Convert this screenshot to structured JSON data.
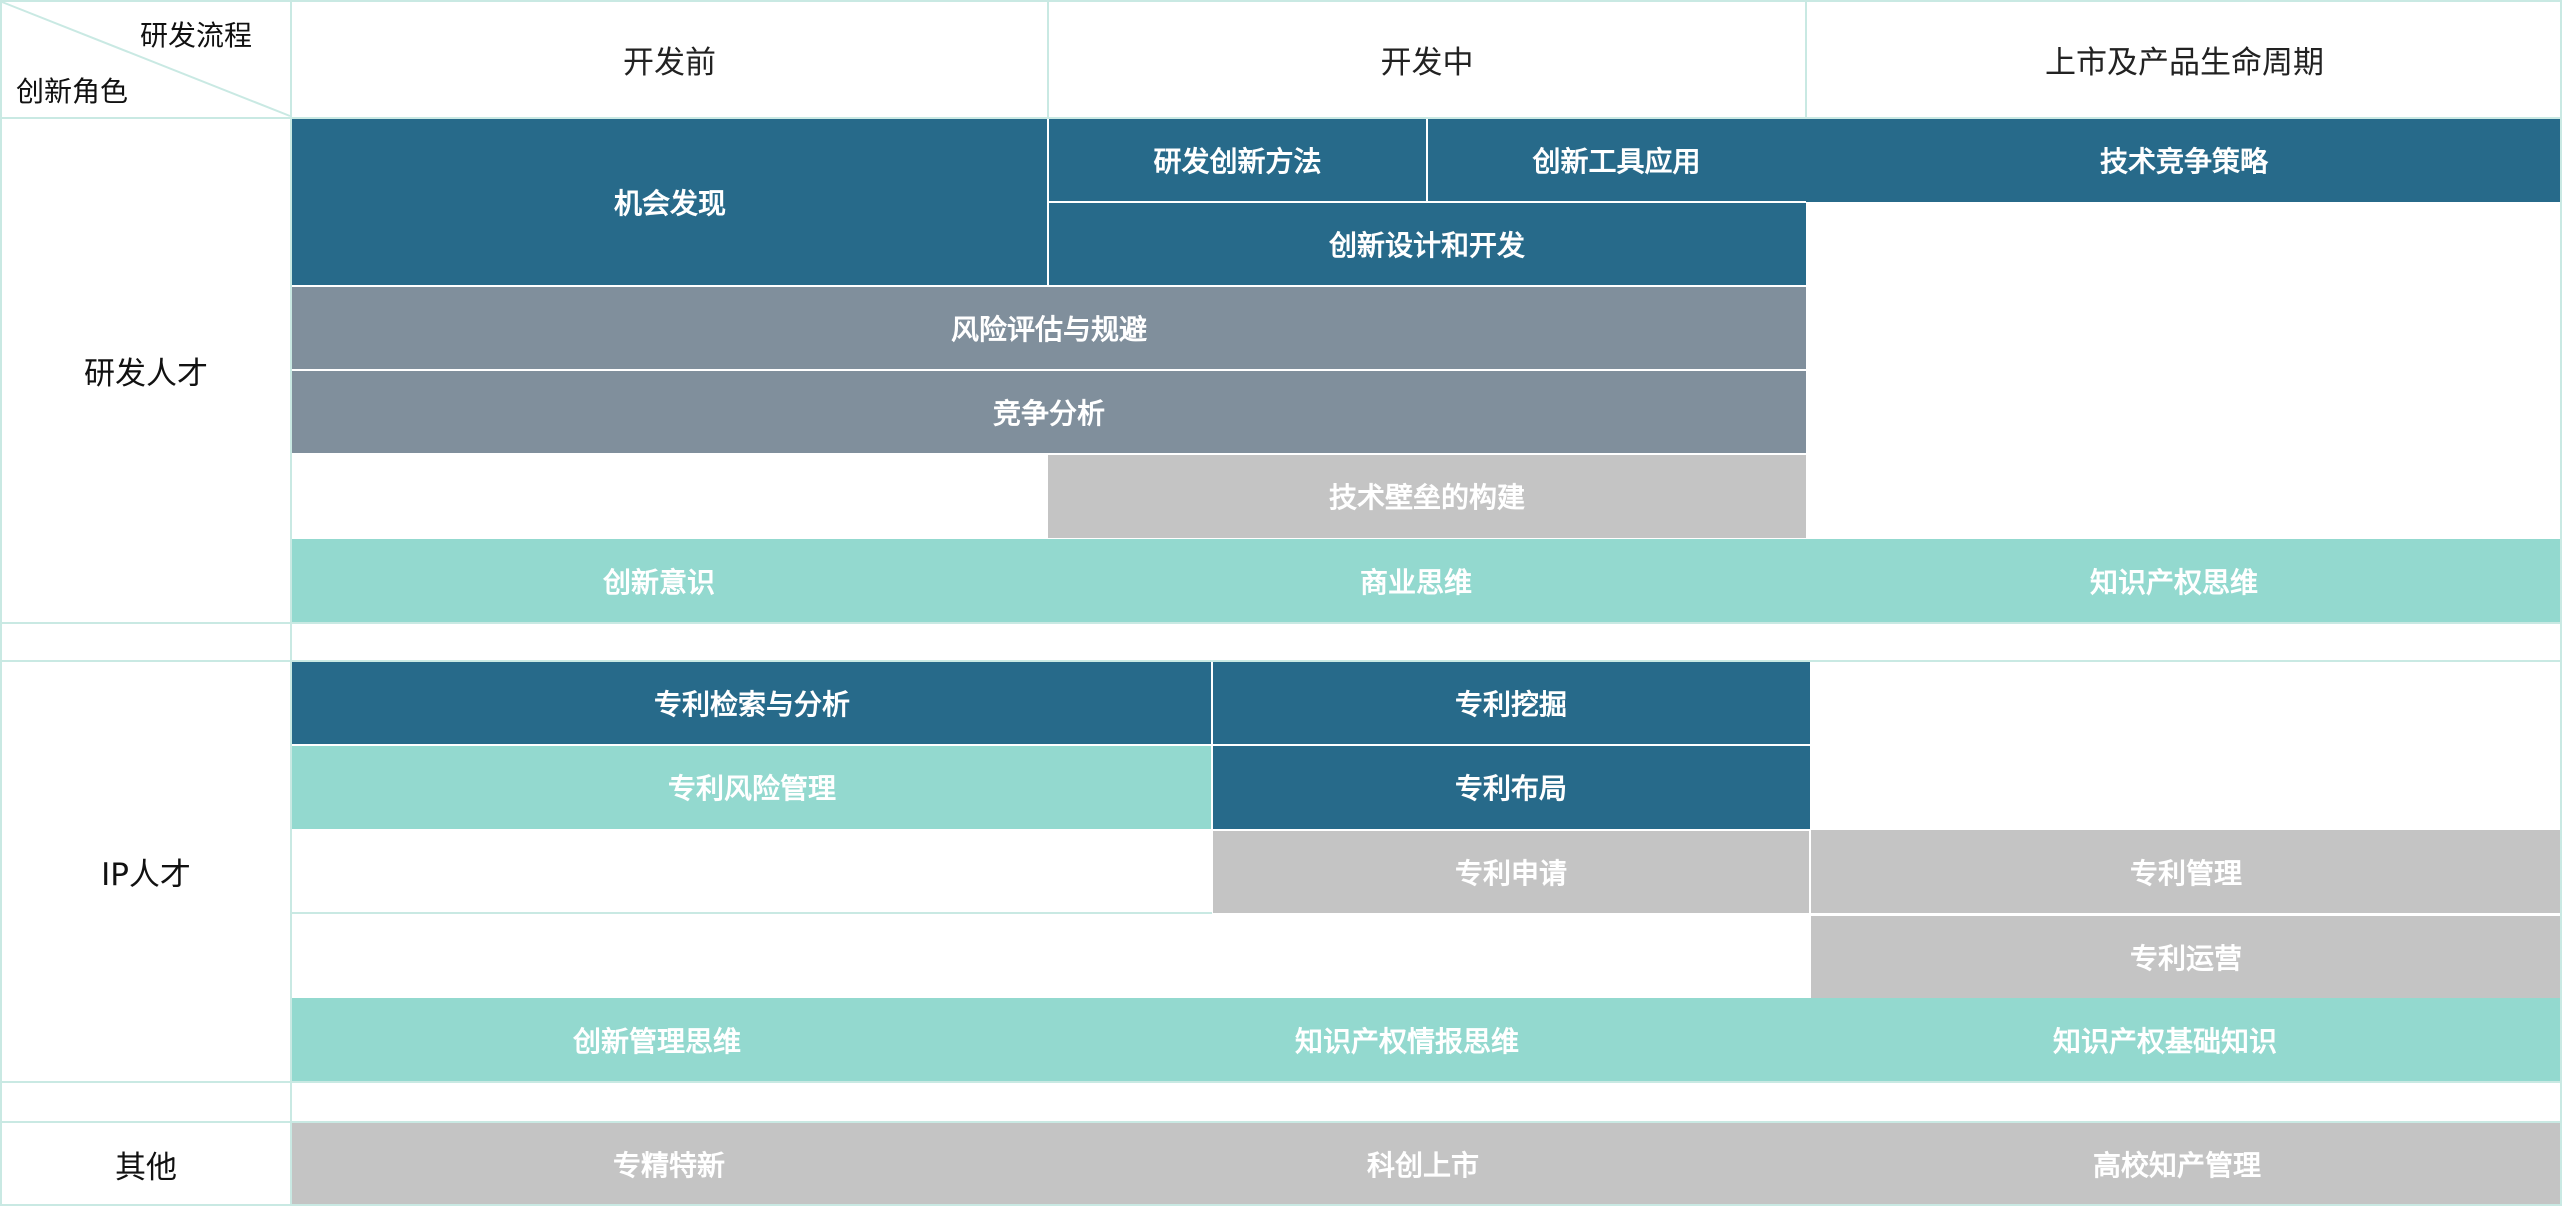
{
  "corner": {
    "process_label": "研发流程",
    "role_label": "创新角色"
  },
  "stages": [
    "开发前",
    "开发中",
    "上市及产品生命周期"
  ],
  "roles": {
    "rd": "研发人才",
    "ip": "IP人才",
    "other": "其他"
  },
  "rd": {
    "opportunity": "机会发现",
    "rd_methods": "研发创新方法",
    "tool_application": "创新工具应用",
    "tech_strategy": "技术竞争策略",
    "design_dev": "创新设计和开发",
    "risk": "风险评估与规避",
    "competition": "竞争分析",
    "barrier": "技术壁垒的构建",
    "mindsets": [
      "创新意识",
      "商业思维",
      "知识产权思维"
    ]
  },
  "ip": {
    "search": "专利检索与分析",
    "mining": "专利挖掘",
    "risk_mgmt": "专利风险管理",
    "layout": "专利布局",
    "application": "专利申请",
    "management": "专利管理",
    "operation": "专利运营",
    "mindsets": [
      "创新管理思维",
      "知识产权情报思维",
      "知识产权基础知识"
    ]
  },
  "other": {
    "items": [
      "专精特新",
      "科创上市",
      "高校知产管理"
    ]
  },
  "colors": {
    "dark": "#276a8a",
    "slate": "#808f9c",
    "light_gray": "#c4c4c4",
    "mint": "#93d9cf",
    "grid": "#c9e9e3"
  }
}
